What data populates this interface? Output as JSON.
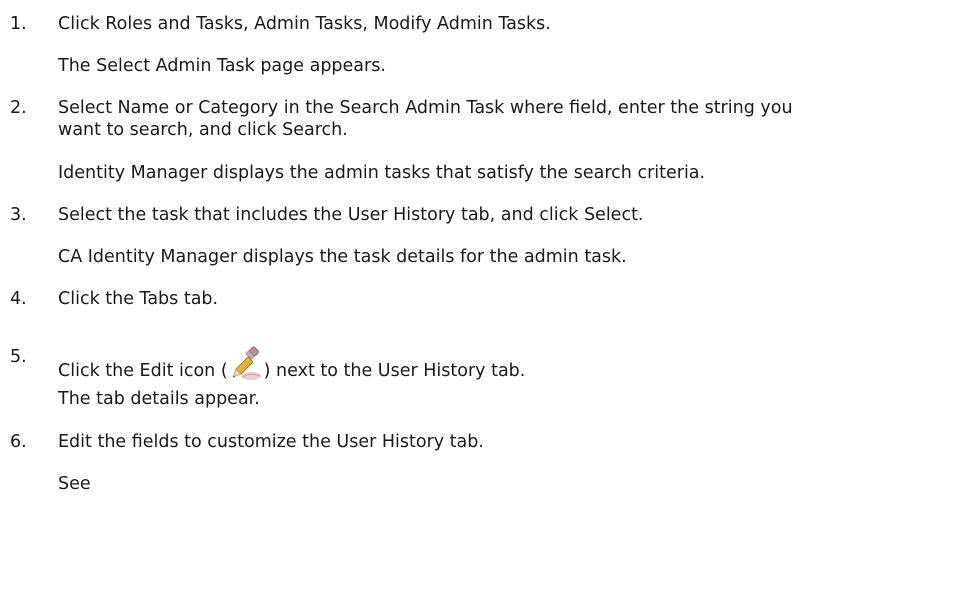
{
  "steps": [
    {
      "number": "1.",
      "lines": [
        "Click Roles and Tasks, Admin Tasks, Modify Admin Tasks."
      ],
      "result": "The Select Admin Task page appears."
    },
    {
      "number": "2.",
      "lines": [
        "Select Name or Category in the Search Admin Task where field, enter the string you",
        "want to search, and click Search."
      ],
      "result": "Identity Manager displays the admin tasks that satisfy the search criteria."
    },
    {
      "number": "3.",
      "lines": [
        "Select the task that includes the User History tab, and click Select."
      ],
      "result": "CA Identity Manager displays the task details for the admin task."
    },
    {
      "number": "4.",
      "lines": [
        "Click the Tabs tab."
      ]
    },
    {
      "number": "5.",
      "before_icon": "Click the Edit icon (",
      "icon": "edit-pencil-icon",
      "after_icon": ") next to the User History tab.",
      "result": "The tab details appear."
    },
    {
      "number": "6.",
      "lines": [
        "Edit the fields to customize the User History tab."
      ],
      "result": "See"
    }
  ]
}
